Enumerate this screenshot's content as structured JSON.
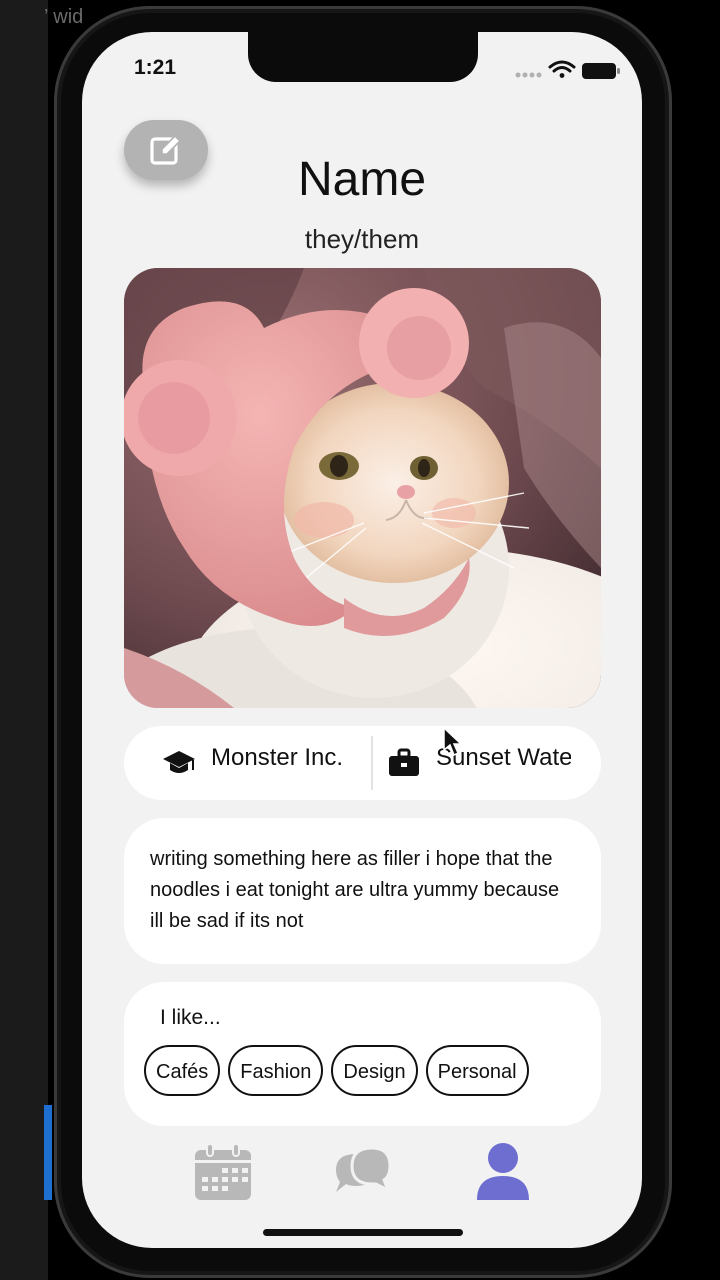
{
  "desktop": {
    "fragment_text": "’ wid"
  },
  "status_bar": {
    "time": "1:21"
  },
  "profile": {
    "name": "Name",
    "pronouns": "they/them",
    "photo_description": "cat-photo-with-pink-bear-hat"
  },
  "info": {
    "school": "Monster Inc.",
    "work": "Sunset Water"
  },
  "bio": {
    "text": "writing something here as filler i hope that the noodles i eat tonight are ultra yummy because ill be sad if its not"
  },
  "likes": {
    "heading": "I like...",
    "tags": [
      "Cafés",
      "Fashion",
      "Design",
      "Personal"
    ]
  },
  "tab_bar": {
    "items": [
      {
        "icon": "calendar-icon",
        "active": false
      },
      {
        "icon": "chat-bubbles-icon",
        "active": false
      },
      {
        "icon": "profile-icon",
        "active": true
      }
    ],
    "active_color": "#6e6ed0",
    "inactive_color": "#b8b8b8"
  },
  "colors": {
    "screen_bg": "#f2f2f2",
    "card_bg": "#ffffff",
    "edit_button_bg": "#b3b3b3"
  }
}
